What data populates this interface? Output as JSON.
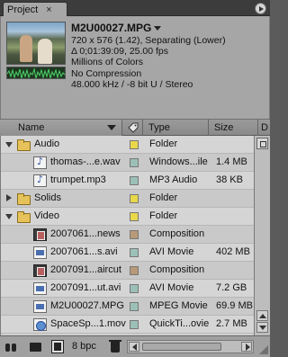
{
  "panel": {
    "tab_label": "Project",
    "close_glyph": "×"
  },
  "preview": {
    "clip_name": "M2U00027.MPG",
    "line1": "720 x 576 (1.42), Separating (Lower)",
    "line2": "Δ 0;01:39:09, 25.00 fps",
    "line3": "Millions of Colors",
    "line4": "No Compression",
    "line5": "48.000 kHz / -8 bit U / Stereo"
  },
  "columns": {
    "name": "Name",
    "label_icon": "tag-icon",
    "type": "Type",
    "size": "Size",
    "extra": "D"
  },
  "colors": {
    "yellow": "#e8d84a",
    "teal": "#9cc0b8",
    "tan": "#b89a78",
    "brown": "#a88e74"
  },
  "rows": [
    {
      "kind": "folder",
      "expanded": true,
      "name": "Audio",
      "label_color": "#e8d84a",
      "type": "Folder",
      "size": ""
    },
    {
      "kind": "audio",
      "name": "thomas-...e.wav",
      "label_color": "#9cc0b8",
      "type": "Windows...ile",
      "size": "1.4 MB"
    },
    {
      "kind": "audio",
      "name": "trumpet.mp3",
      "label_color": "#9cc0b8",
      "type": "MP3 Audio",
      "size": "38 KB"
    },
    {
      "kind": "folder",
      "expanded": false,
      "name": "Solids",
      "label_color": "#e8d84a",
      "type": "Folder",
      "size": ""
    },
    {
      "kind": "folder",
      "expanded": true,
      "name": "Video",
      "label_color": "#e8d84a",
      "type": "Folder",
      "size": ""
    },
    {
      "kind": "comp",
      "name": "2007061...news",
      "label_color": "#b89a78",
      "type": "Composition",
      "size": ""
    },
    {
      "kind": "movie",
      "name": "2007061...s.avi",
      "label_color": "#9cc0b8",
      "type": "AVI Movie",
      "size": "402 MB"
    },
    {
      "kind": "comp",
      "name": "2007091...aircut",
      "label_color": "#b89a78",
      "type": "Composition",
      "size": ""
    },
    {
      "kind": "movie",
      "name": "2007091...ut.avi",
      "label_color": "#9cc0b8",
      "type": "AVI Movie",
      "size": "7.2 GB"
    },
    {
      "kind": "movie",
      "name": "M2U00027.MPG",
      "label_color": "#9cc0b8",
      "type": "MPEG Movie",
      "size": "69.9 MB"
    },
    {
      "kind": "qt",
      "name": "SpaceSp...1.mov",
      "label_color": "#9cc0b8",
      "type": "QuickTi...ovie",
      "size": "2.7 MB"
    }
  ],
  "toolbar": {
    "bpc_label": "8 bpc"
  }
}
